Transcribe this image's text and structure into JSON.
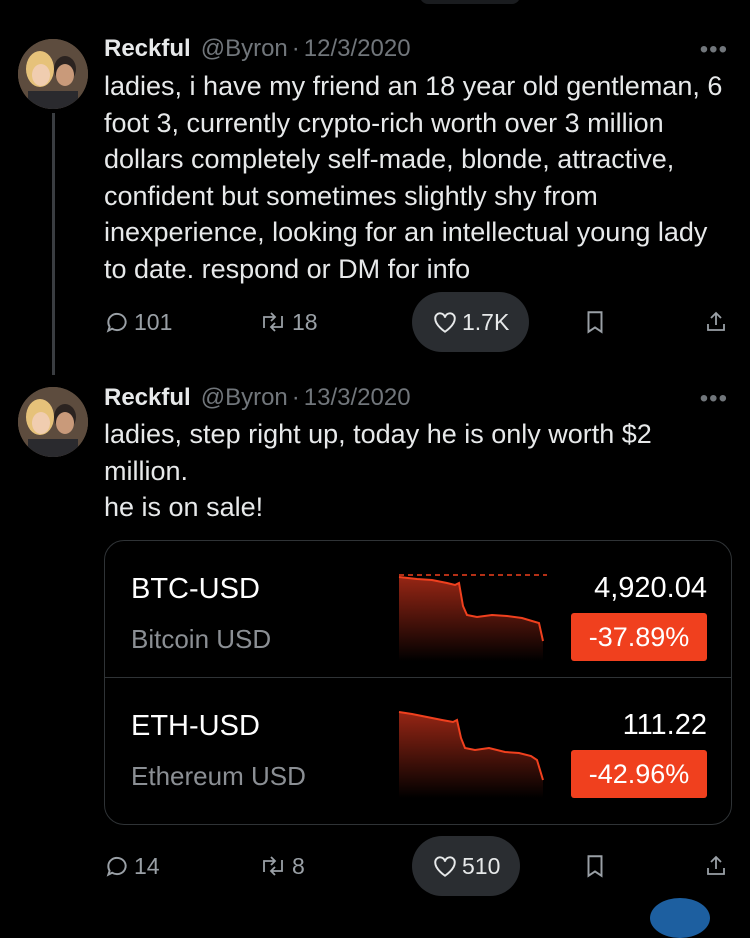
{
  "tweets": [
    {
      "name": "Reckful",
      "handle": "@Byron",
      "sep": "·",
      "date": "12/3/2020",
      "more": "•••",
      "text": "ladies, i have my friend an 18 year old gentleman, 6 foot 3, currently crypto-rich worth over 3 million dollars completely self-made, blonde, attractive, confident but sometimes slightly shy from inexperience, looking for an intellectual young lady to date. respond or DM for info",
      "stats": {
        "replies": "101",
        "reposts": "18",
        "likes": "1.7K"
      }
    },
    {
      "name": "Reckful",
      "handle": "@Byron",
      "sep": "·",
      "date": "13/3/2020",
      "more": "•••",
      "text_lines": [
        "ladies, step right up, today he is only worth $2 million.",
        "he is on sale!"
      ],
      "stats": {
        "replies": "14",
        "reposts": "8",
        "likes": "510"
      }
    }
  ],
  "card": {
    "rows": [
      {
        "ticker": "BTC-USD",
        "name": "Bitcoin USD",
        "price": "4,920.04",
        "change": "-37.89%"
      },
      {
        "ticker": "ETH-USD",
        "name": "Ethereum USD",
        "price": "111.22",
        "change": "-42.96%"
      }
    ]
  },
  "colors": {
    "negative": "#f0401e",
    "text": "#e7e9ea",
    "muted": "#71767b",
    "background": "#000000"
  },
  "icons": [
    "reply-icon",
    "repost-icon",
    "like-icon",
    "bookmark-icon",
    "share-icon",
    "more-icon"
  ]
}
